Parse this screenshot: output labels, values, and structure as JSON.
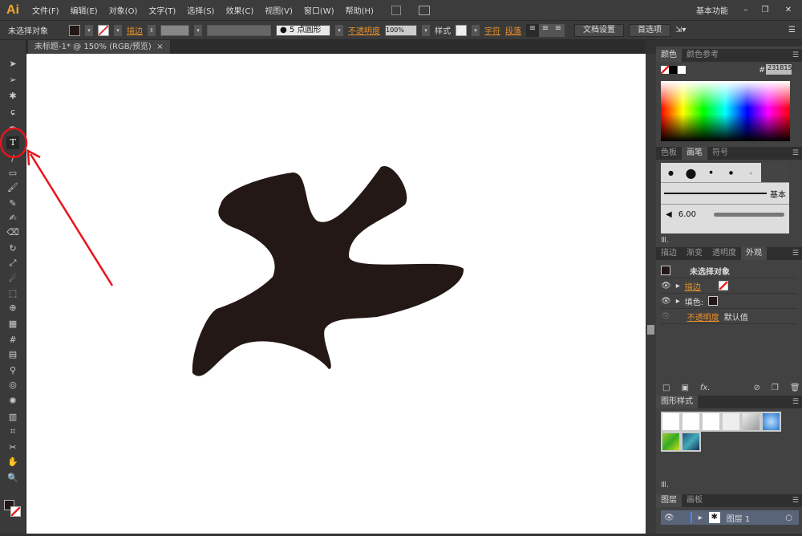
{
  "app": {
    "logo": "Ai",
    "workspace": "基本功能"
  },
  "menu": [
    "文件(F)",
    "编辑(E)",
    "对象(O)",
    "文字(T)",
    "选择(S)",
    "效果(C)",
    "视图(V)",
    "窗口(W)",
    "帮助(H)"
  ],
  "control": {
    "selection": "未选择对象",
    "stroke_label": "描边",
    "brush": "5 点圆形",
    "opacity_label": "不透明度",
    "opacity": "100%",
    "style_label": "样式",
    "char": "字符",
    "para": "段落",
    "doc_setup": "文档设置",
    "prefs": "首选项"
  },
  "document_tab": {
    "title": "未标题-1* @ 150% (RGB/预览)",
    "close": "×"
  },
  "color_panel": {
    "tabs": [
      "颜色",
      "颜色参考"
    ],
    "hex_label": "#",
    "hex": "231815"
  },
  "brush_panel": {
    "tabs": [
      "色板",
      "画笔",
      "符号"
    ],
    "basic": "基本",
    "size": "6.00"
  },
  "appearance_panel": {
    "tabs": [
      "描边",
      "渐变",
      "透明度",
      "外观"
    ],
    "title": "未选择对象",
    "stroke": "描边",
    "fill": "填色:",
    "opacity": "不透明度",
    "opacity_value": "默认值",
    "fx": "fx."
  },
  "graphic_styles": {
    "tab": "图形样式"
  },
  "layers_panel": {
    "tabs": [
      "图层",
      "画板"
    ],
    "layer": "图层 1"
  },
  "colors": {
    "shape": "#231815",
    "annotation": "#e8141b"
  }
}
